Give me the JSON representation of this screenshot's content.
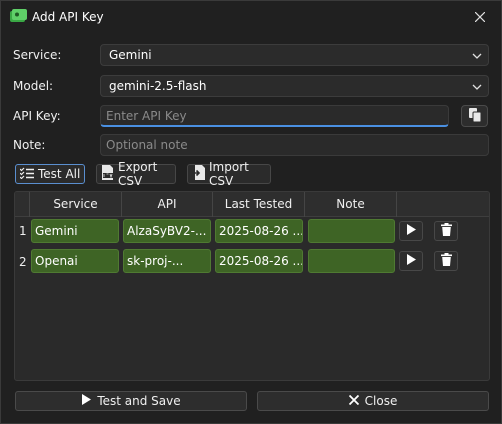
{
  "window": {
    "title": "Add API Key",
    "icons": {
      "app": "key-icon",
      "close": "close-icon"
    }
  },
  "form": {
    "service_label": "Service:",
    "service_value": "Gemini",
    "model_label": "Model:",
    "model_value": "gemini-2.5-flash",
    "api_key_label": "API Key:",
    "api_key_placeholder": "Enter API Key",
    "note_label": "Note:",
    "note_placeholder": "Optional note"
  },
  "toolbar": {
    "test_all": "Test All",
    "export_csv": "Export CSV",
    "import_csv": "Import CSV"
  },
  "table": {
    "columns": [
      "Service",
      "API",
      "Last Tested",
      "Note"
    ],
    "rows": [
      {
        "num": "1",
        "service": "Gemini",
        "api": "AlzaSyBV2-...",
        "last_tested": "2025-08-26 ...",
        "note": ""
      },
      {
        "num": "2",
        "service": "Openai",
        "api": "sk-proj-...",
        "last_tested": "2025-08-26 ...",
        "note": ""
      }
    ]
  },
  "footer": {
    "test_save": "Test and Save",
    "close": "Close"
  },
  "colors": {
    "cell_green": "#3e6425",
    "focus_blue": "#4a90e2"
  }
}
